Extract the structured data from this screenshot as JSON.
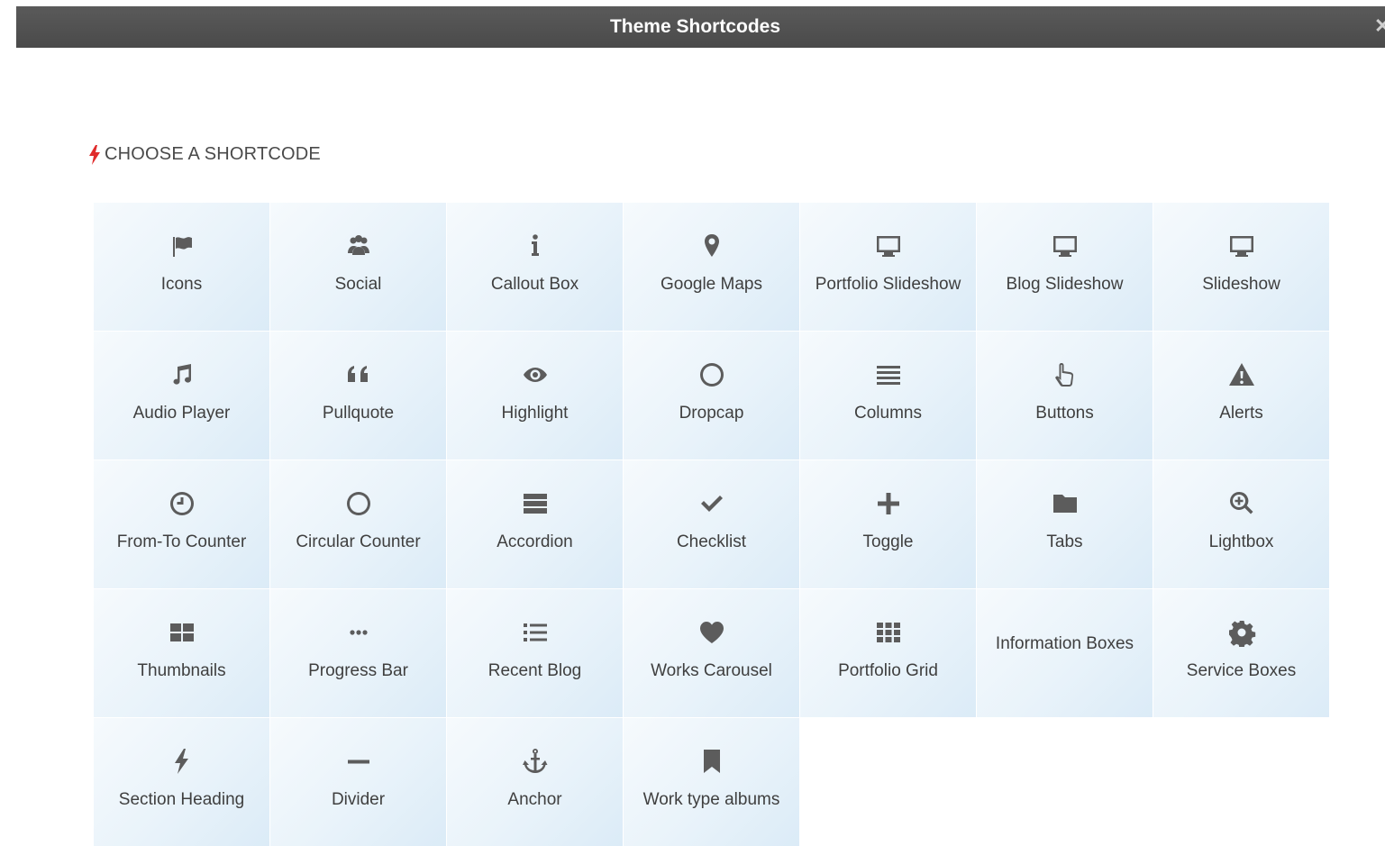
{
  "window": {
    "title": "Theme Shortcodes"
  },
  "section": {
    "heading": "CHOOSE A SHORTCODE",
    "accent": "#e02b2b"
  },
  "tiles": [
    {
      "label": "Icons",
      "icon": "flag-icon"
    },
    {
      "label": "Social",
      "icon": "users-icon"
    },
    {
      "label": "Callout Box",
      "icon": "info-icon"
    },
    {
      "label": "Google Maps",
      "icon": "map-pin-icon"
    },
    {
      "label": "Portfolio Slideshow",
      "icon": "monitor-icon"
    },
    {
      "label": "Blog Slideshow",
      "icon": "monitor-icon"
    },
    {
      "label": "Slideshow",
      "icon": "monitor-icon"
    },
    {
      "label": "Audio Player",
      "icon": "music-icon"
    },
    {
      "label": "Pullquote",
      "icon": "quote-icon"
    },
    {
      "label": "Highlight",
      "icon": "eye-icon"
    },
    {
      "label": "Dropcap",
      "icon": "circle-icon"
    },
    {
      "label": "Columns",
      "icon": "lines-icon"
    },
    {
      "label": "Buttons",
      "icon": "pointer-hand-icon"
    },
    {
      "label": "Alerts",
      "icon": "warning-icon"
    },
    {
      "label": "From-To Counter",
      "icon": "clock-icon"
    },
    {
      "label": "Circular Counter",
      "icon": "circle-icon"
    },
    {
      "label": "Accordion",
      "icon": "stack-icon"
    },
    {
      "label": "Checklist",
      "icon": "check-icon"
    },
    {
      "label": "Toggle",
      "icon": "plus-icon"
    },
    {
      "label": "Tabs",
      "icon": "folder-icon"
    },
    {
      "label": "Lightbox",
      "icon": "zoom-in-icon"
    },
    {
      "label": "Thumbnails",
      "icon": "grid-large-icon"
    },
    {
      "label": "Progress Bar",
      "icon": "ellipsis-icon"
    },
    {
      "label": "Recent Blog",
      "icon": "list-icon"
    },
    {
      "label": "Works Carousel",
      "icon": "heart-icon"
    },
    {
      "label": "Portfolio Grid",
      "icon": "grid-small-icon"
    },
    {
      "label": "Information Boxes",
      "icon": ""
    },
    {
      "label": "Service Boxes",
      "icon": "gear-icon"
    },
    {
      "label": "Section Heading",
      "icon": "bolt-icon"
    },
    {
      "label": "Divider",
      "icon": "minus-icon"
    },
    {
      "label": "Anchor",
      "icon": "anchor-icon"
    },
    {
      "label": "Work type albums",
      "icon": "bookmark-icon"
    }
  ]
}
